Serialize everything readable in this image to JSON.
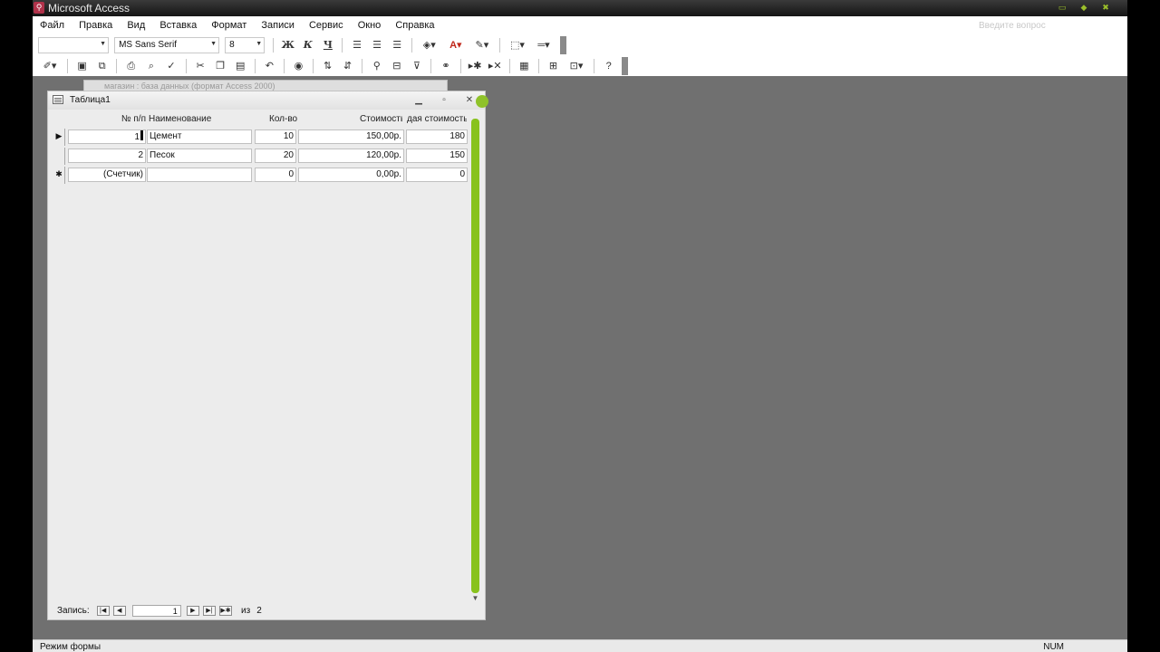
{
  "window": {
    "title": "Microsoft Access"
  },
  "menu": [
    "Файл",
    "Правка",
    "Вид",
    "Вставка",
    "Формат",
    "Записи",
    "Сервис",
    "Окно",
    "Справка"
  ],
  "help_placeholder": "Введите вопрос",
  "toolbar": {
    "object_value": "",
    "font_value": "MS Sans Serif",
    "size_value": "8",
    "bold_label": "Ж",
    "italic_label": "К",
    "underline_label": "Ч",
    "font_color_label": "A"
  },
  "background_window": {
    "title": "магазин : база данных (формат Access 2000)"
  },
  "form": {
    "title": "Таблица1",
    "columns": [
      "№ п/п",
      "Наименование",
      "Кол-во",
      "Стоимость",
      "дая стоимость"
    ],
    "rows": [
      {
        "selector": "▶",
        "num": "1",
        "name": "Цемент",
        "qty": "10",
        "cost": "150,00р.",
        "total": "180"
      },
      {
        "selector": "",
        "num": "2",
        "name": "Песок",
        "qty": "20",
        "cost": "120,00р.",
        "total": "150"
      },
      {
        "selector": "✱",
        "num": "(Счетчик)",
        "name": "",
        "qty": "0",
        "cost": "0,00р.",
        "total": "0"
      }
    ],
    "navigation": {
      "label": "Запись:",
      "current": "1",
      "of_label": "из",
      "total": "2"
    }
  },
  "status": {
    "left": "Режим формы",
    "right": "NUM"
  },
  "colors": {
    "scrollbar": "#88c21d",
    "workspace": "#707070"
  }
}
